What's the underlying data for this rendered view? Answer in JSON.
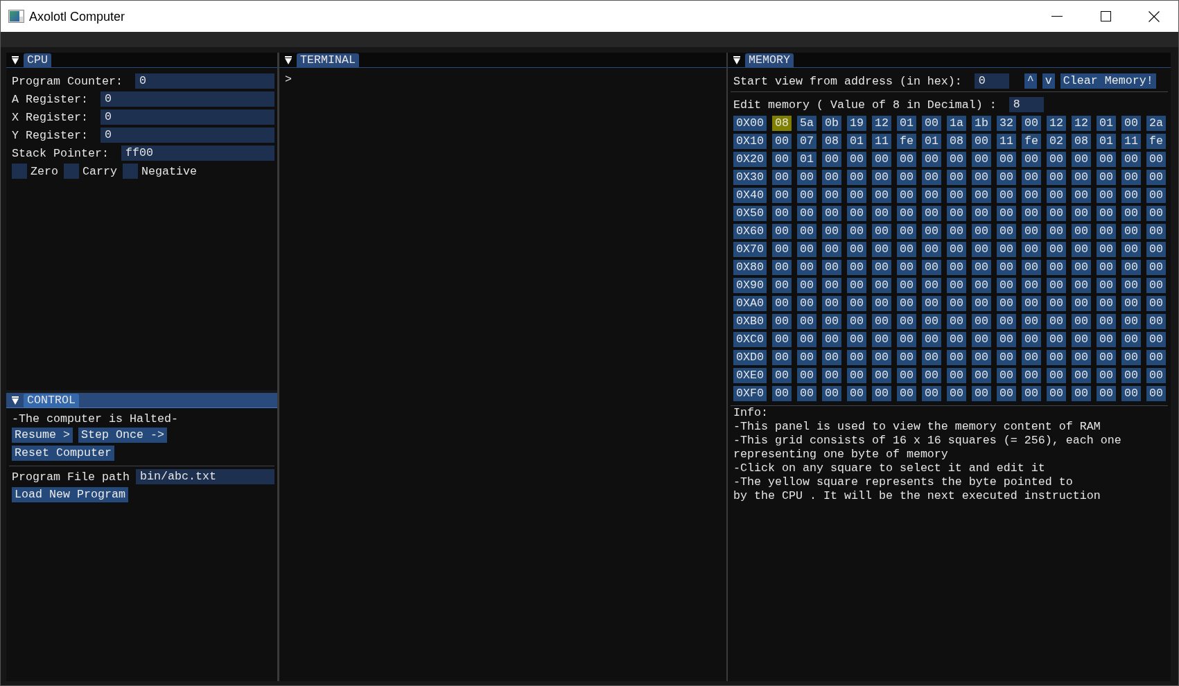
{
  "window": {
    "title": "Axolotl Computer"
  },
  "cpu": {
    "tab": "CPU",
    "focused": false,
    "registers": [
      {
        "label": "Program Counter:",
        "value": "0"
      },
      {
        "label": "A Register:",
        "value": "0"
      },
      {
        "label": "X Register:",
        "value": "0"
      },
      {
        "label": "Y Register:",
        "value": "0"
      },
      {
        "label": "Stack Pointer:",
        "value": "ff00"
      }
    ],
    "flags": [
      {
        "label": "Zero",
        "checked": false
      },
      {
        "label": "Carry",
        "checked": false
      },
      {
        "label": "Negative",
        "checked": false
      }
    ]
  },
  "control": {
    "tab": "CONTROL",
    "focused": true,
    "status": "-The computer is Halted-",
    "button_rows": [
      [
        "Resume >",
        "Step Once ->"
      ],
      [
        "Reset Computer"
      ]
    ],
    "file_path": {
      "label": "Program File path",
      "value": "bin/abc.txt"
    },
    "load_button": "Load New Program"
  },
  "terminal": {
    "tab": "TERMINAL",
    "focused": false,
    "prompt": ">"
  },
  "memory": {
    "tab": "MEMORY",
    "focused": false,
    "start_address": {
      "label": "Start view from address (in hex):",
      "value": "0"
    },
    "buttons": [
      "^",
      "v",
      "Clear Memory!"
    ],
    "edit": {
      "label": "Edit memory ( Value of 8 in Decimal) :",
      "value": "8"
    },
    "rows": [
      {
        "address": "0X00",
        "cells": [
          {
            "value": "08",
            "current": true
          },
          {
            "value": "5a",
            "current": false
          },
          {
            "value": "0b",
            "current": false
          },
          {
            "value": "19",
            "current": false
          },
          {
            "value": "12",
            "current": false
          },
          {
            "value": "01",
            "current": false
          },
          {
            "value": "00",
            "current": false
          },
          {
            "value": "1a",
            "current": false
          },
          {
            "value": "1b",
            "current": false
          },
          {
            "value": "32",
            "current": false
          },
          {
            "value": "00",
            "current": false
          },
          {
            "value": "12",
            "current": false
          },
          {
            "value": "12",
            "current": false
          },
          {
            "value": "01",
            "current": false
          },
          {
            "value": "00",
            "current": false
          },
          {
            "value": "2a",
            "current": false
          }
        ]
      },
      {
        "address": "0X10",
        "cells": [
          {
            "value": "00",
            "current": false
          },
          {
            "value": "07",
            "current": false
          },
          {
            "value": "08",
            "current": false
          },
          {
            "value": "01",
            "current": false
          },
          {
            "value": "11",
            "current": false
          },
          {
            "value": "fe",
            "current": false
          },
          {
            "value": "01",
            "current": false
          },
          {
            "value": "08",
            "current": false
          },
          {
            "value": "00",
            "current": false
          },
          {
            "value": "11",
            "current": false
          },
          {
            "value": "fe",
            "current": false
          },
          {
            "value": "02",
            "current": false
          },
          {
            "value": "08",
            "current": false
          },
          {
            "value": "01",
            "current": false
          },
          {
            "value": "11",
            "current": false
          },
          {
            "value": "fe",
            "current": false
          }
        ]
      },
      {
        "address": "0X20",
        "cells": [
          {
            "value": "00",
            "current": false
          },
          {
            "value": "01",
            "current": false
          },
          {
            "value": "00",
            "current": false
          },
          {
            "value": "00",
            "current": false
          },
          {
            "value": "00",
            "current": false
          },
          {
            "value": "00",
            "current": false
          },
          {
            "value": "00",
            "current": false
          },
          {
            "value": "00",
            "current": false
          },
          {
            "value": "00",
            "current": false
          },
          {
            "value": "00",
            "current": false
          },
          {
            "value": "00",
            "current": false
          },
          {
            "value": "00",
            "current": false
          },
          {
            "value": "00",
            "current": false
          },
          {
            "value": "00",
            "current": false
          },
          {
            "value": "00",
            "current": false
          },
          {
            "value": "00",
            "current": false
          }
        ]
      },
      {
        "address": "0X30",
        "cells": [
          {
            "value": "00",
            "current": false
          },
          {
            "value": "00",
            "current": false
          },
          {
            "value": "00",
            "current": false
          },
          {
            "value": "00",
            "current": false
          },
          {
            "value": "00",
            "current": false
          },
          {
            "value": "00",
            "current": false
          },
          {
            "value": "00",
            "current": false
          },
          {
            "value": "00",
            "current": false
          },
          {
            "value": "00",
            "current": false
          },
          {
            "value": "00",
            "current": false
          },
          {
            "value": "00",
            "current": false
          },
          {
            "value": "00",
            "current": false
          },
          {
            "value": "00",
            "current": false
          },
          {
            "value": "00",
            "current": false
          },
          {
            "value": "00",
            "current": false
          },
          {
            "value": "00",
            "current": false
          }
        ]
      },
      {
        "address": "0X40",
        "cells": [
          {
            "value": "00",
            "current": false
          },
          {
            "value": "00",
            "current": false
          },
          {
            "value": "00",
            "current": false
          },
          {
            "value": "00",
            "current": false
          },
          {
            "value": "00",
            "current": false
          },
          {
            "value": "00",
            "current": false
          },
          {
            "value": "00",
            "current": false
          },
          {
            "value": "00",
            "current": false
          },
          {
            "value": "00",
            "current": false
          },
          {
            "value": "00",
            "current": false
          },
          {
            "value": "00",
            "current": false
          },
          {
            "value": "00",
            "current": false
          },
          {
            "value": "00",
            "current": false
          },
          {
            "value": "00",
            "current": false
          },
          {
            "value": "00",
            "current": false
          },
          {
            "value": "00",
            "current": false
          }
        ]
      },
      {
        "address": "0X50",
        "cells": [
          {
            "value": "00",
            "current": false
          },
          {
            "value": "00",
            "current": false
          },
          {
            "value": "00",
            "current": false
          },
          {
            "value": "00",
            "current": false
          },
          {
            "value": "00",
            "current": false
          },
          {
            "value": "00",
            "current": false
          },
          {
            "value": "00",
            "current": false
          },
          {
            "value": "00",
            "current": false
          },
          {
            "value": "00",
            "current": false
          },
          {
            "value": "00",
            "current": false
          },
          {
            "value": "00",
            "current": false
          },
          {
            "value": "00",
            "current": false
          },
          {
            "value": "00",
            "current": false
          },
          {
            "value": "00",
            "current": false
          },
          {
            "value": "00",
            "current": false
          },
          {
            "value": "00",
            "current": false
          }
        ]
      },
      {
        "address": "0X60",
        "cells": [
          {
            "value": "00",
            "current": false
          },
          {
            "value": "00",
            "current": false
          },
          {
            "value": "00",
            "current": false
          },
          {
            "value": "00",
            "current": false
          },
          {
            "value": "00",
            "current": false
          },
          {
            "value": "00",
            "current": false
          },
          {
            "value": "00",
            "current": false
          },
          {
            "value": "00",
            "current": false
          },
          {
            "value": "00",
            "current": false
          },
          {
            "value": "00",
            "current": false
          },
          {
            "value": "00",
            "current": false
          },
          {
            "value": "00",
            "current": false
          },
          {
            "value": "00",
            "current": false
          },
          {
            "value": "00",
            "current": false
          },
          {
            "value": "00",
            "current": false
          },
          {
            "value": "00",
            "current": false
          }
        ]
      },
      {
        "address": "0X70",
        "cells": [
          {
            "value": "00",
            "current": false
          },
          {
            "value": "00",
            "current": false
          },
          {
            "value": "00",
            "current": false
          },
          {
            "value": "00",
            "current": false
          },
          {
            "value": "00",
            "current": false
          },
          {
            "value": "00",
            "current": false
          },
          {
            "value": "00",
            "current": false
          },
          {
            "value": "00",
            "current": false
          },
          {
            "value": "00",
            "current": false
          },
          {
            "value": "00",
            "current": false
          },
          {
            "value": "00",
            "current": false
          },
          {
            "value": "00",
            "current": false
          },
          {
            "value": "00",
            "current": false
          },
          {
            "value": "00",
            "current": false
          },
          {
            "value": "00",
            "current": false
          },
          {
            "value": "00",
            "current": false
          }
        ]
      },
      {
        "address": "0X80",
        "cells": [
          {
            "value": "00",
            "current": false
          },
          {
            "value": "00",
            "current": false
          },
          {
            "value": "00",
            "current": false
          },
          {
            "value": "00",
            "current": false
          },
          {
            "value": "00",
            "current": false
          },
          {
            "value": "00",
            "current": false
          },
          {
            "value": "00",
            "current": false
          },
          {
            "value": "00",
            "current": false
          },
          {
            "value": "00",
            "current": false
          },
          {
            "value": "00",
            "current": false
          },
          {
            "value": "00",
            "current": false
          },
          {
            "value": "00",
            "current": false
          },
          {
            "value": "00",
            "current": false
          },
          {
            "value": "00",
            "current": false
          },
          {
            "value": "00",
            "current": false
          },
          {
            "value": "00",
            "current": false
          }
        ]
      },
      {
        "address": "0X90",
        "cells": [
          {
            "value": "00",
            "current": false
          },
          {
            "value": "00",
            "current": false
          },
          {
            "value": "00",
            "current": false
          },
          {
            "value": "00",
            "current": false
          },
          {
            "value": "00",
            "current": false
          },
          {
            "value": "00",
            "current": false
          },
          {
            "value": "00",
            "current": false
          },
          {
            "value": "00",
            "current": false
          },
          {
            "value": "00",
            "current": false
          },
          {
            "value": "00",
            "current": false
          },
          {
            "value": "00",
            "current": false
          },
          {
            "value": "00",
            "current": false
          },
          {
            "value": "00",
            "current": false
          },
          {
            "value": "00",
            "current": false
          },
          {
            "value": "00",
            "current": false
          },
          {
            "value": "00",
            "current": false
          }
        ]
      },
      {
        "address": "0XA0",
        "cells": [
          {
            "value": "00",
            "current": false
          },
          {
            "value": "00",
            "current": false
          },
          {
            "value": "00",
            "current": false
          },
          {
            "value": "00",
            "current": false
          },
          {
            "value": "00",
            "current": false
          },
          {
            "value": "00",
            "current": false
          },
          {
            "value": "00",
            "current": false
          },
          {
            "value": "00",
            "current": false
          },
          {
            "value": "00",
            "current": false
          },
          {
            "value": "00",
            "current": false
          },
          {
            "value": "00",
            "current": false
          },
          {
            "value": "00",
            "current": false
          },
          {
            "value": "00",
            "current": false
          },
          {
            "value": "00",
            "current": false
          },
          {
            "value": "00",
            "current": false
          },
          {
            "value": "00",
            "current": false
          }
        ]
      },
      {
        "address": "0XB0",
        "cells": [
          {
            "value": "00",
            "current": false
          },
          {
            "value": "00",
            "current": false
          },
          {
            "value": "00",
            "current": false
          },
          {
            "value": "00",
            "current": false
          },
          {
            "value": "00",
            "current": false
          },
          {
            "value": "00",
            "current": false
          },
          {
            "value": "00",
            "current": false
          },
          {
            "value": "00",
            "current": false
          },
          {
            "value": "00",
            "current": false
          },
          {
            "value": "00",
            "current": false
          },
          {
            "value": "00",
            "current": false
          },
          {
            "value": "00",
            "current": false
          },
          {
            "value": "00",
            "current": false
          },
          {
            "value": "00",
            "current": false
          },
          {
            "value": "00",
            "current": false
          },
          {
            "value": "00",
            "current": false
          }
        ]
      },
      {
        "address": "0XC0",
        "cells": [
          {
            "value": "00",
            "current": false
          },
          {
            "value": "00",
            "current": false
          },
          {
            "value": "00",
            "current": false
          },
          {
            "value": "00",
            "current": false
          },
          {
            "value": "00",
            "current": false
          },
          {
            "value": "00",
            "current": false
          },
          {
            "value": "00",
            "current": false
          },
          {
            "value": "00",
            "current": false
          },
          {
            "value": "00",
            "current": false
          },
          {
            "value": "00",
            "current": false
          },
          {
            "value": "00",
            "current": false
          },
          {
            "value": "00",
            "current": false
          },
          {
            "value": "00",
            "current": false
          },
          {
            "value": "00",
            "current": false
          },
          {
            "value": "00",
            "current": false
          },
          {
            "value": "00",
            "current": false
          }
        ]
      },
      {
        "address": "0XD0",
        "cells": [
          {
            "value": "00",
            "current": false
          },
          {
            "value": "00",
            "current": false
          },
          {
            "value": "00",
            "current": false
          },
          {
            "value": "00",
            "current": false
          },
          {
            "value": "00",
            "current": false
          },
          {
            "value": "00",
            "current": false
          },
          {
            "value": "00",
            "current": false
          },
          {
            "value": "00",
            "current": false
          },
          {
            "value": "00",
            "current": false
          },
          {
            "value": "00",
            "current": false
          },
          {
            "value": "00",
            "current": false
          },
          {
            "value": "00",
            "current": false
          },
          {
            "value": "00",
            "current": false
          },
          {
            "value": "00",
            "current": false
          },
          {
            "value": "00",
            "current": false
          },
          {
            "value": "00",
            "current": false
          }
        ]
      },
      {
        "address": "0XE0",
        "cells": [
          {
            "value": "00",
            "current": false
          },
          {
            "value": "00",
            "current": false
          },
          {
            "value": "00",
            "current": false
          },
          {
            "value": "00",
            "current": false
          },
          {
            "value": "00",
            "current": false
          },
          {
            "value": "00",
            "current": false
          },
          {
            "value": "00",
            "current": false
          },
          {
            "value": "00",
            "current": false
          },
          {
            "value": "00",
            "current": false
          },
          {
            "value": "00",
            "current": false
          },
          {
            "value": "00",
            "current": false
          },
          {
            "value": "00",
            "current": false
          },
          {
            "value": "00",
            "current": false
          },
          {
            "value": "00",
            "current": false
          },
          {
            "value": "00",
            "current": false
          },
          {
            "value": "00",
            "current": false
          }
        ]
      },
      {
        "address": "0XF0",
        "cells": [
          {
            "value": "00",
            "current": false
          },
          {
            "value": "00",
            "current": false
          },
          {
            "value": "00",
            "current": false
          },
          {
            "value": "00",
            "current": false
          },
          {
            "value": "00",
            "current": false
          },
          {
            "value": "00",
            "current": false
          },
          {
            "value": "00",
            "current": false
          },
          {
            "value": "00",
            "current": false
          },
          {
            "value": "00",
            "current": false
          },
          {
            "value": "00",
            "current": false
          },
          {
            "value": "00",
            "current": false
          },
          {
            "value": "00",
            "current": false
          },
          {
            "value": "00",
            "current": false
          },
          {
            "value": "00",
            "current": false
          },
          {
            "value": "00",
            "current": false
          },
          {
            "value": "00",
            "current": false
          }
        ]
      }
    ],
    "info": [
      "Info:",
      "-This panel is used to view the memory content of RAM",
      "-This grid consists of 16 x 16 squares (= 256), each one representing one byte of memory",
      "-Click on any square to select it and edit it",
      "-The yellow square represents the byte pointed to",
      "by the CPU . It will be the next executed instruction"
    ]
  }
}
